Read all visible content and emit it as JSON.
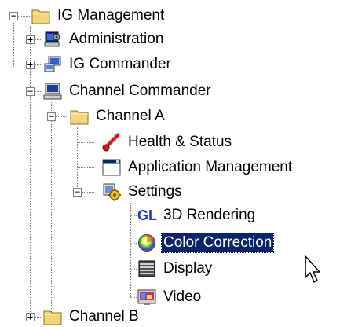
{
  "tree": {
    "root": {
      "label": "IG Management",
      "icon": "folder-icon",
      "expanded": true
    },
    "administration": {
      "label": "Administration",
      "icon": "administration-icon",
      "expanded": false
    },
    "ig_commander": {
      "label": "IG Commander",
      "icon": "ig-commander-icon",
      "expanded": false
    },
    "channel_commander": {
      "label": "Channel Commander",
      "icon": "computer-icon",
      "expanded": true
    },
    "channel_a": {
      "label": "Channel A",
      "icon": "folder-icon",
      "expanded": true
    },
    "health_status": {
      "label": "Health & Status",
      "icon": "thermometer-icon"
    },
    "application_management": {
      "label": "Application Management",
      "icon": "application-window-icon"
    },
    "settings": {
      "label": "Settings",
      "icon": "settings-icon",
      "expanded": true
    },
    "rendering_3d": {
      "label": "3D Rendering",
      "icon_text": "GL"
    },
    "color_correction": {
      "label": "Color Correction",
      "icon": "color-wheel-icon",
      "selected": true
    },
    "display": {
      "label": "Display",
      "icon": "display-icon"
    },
    "video": {
      "label": "Video",
      "icon": "video-icon"
    },
    "channel_b": {
      "label": "Channel B",
      "icon": "folder-icon",
      "expanded": false
    }
  },
  "expander": {
    "collapsed": "+",
    "expanded": "−"
  },
  "colors": {
    "selection": "#0a246a",
    "gl_text": "#1a3ad0",
    "folder": "#f2d77a"
  }
}
